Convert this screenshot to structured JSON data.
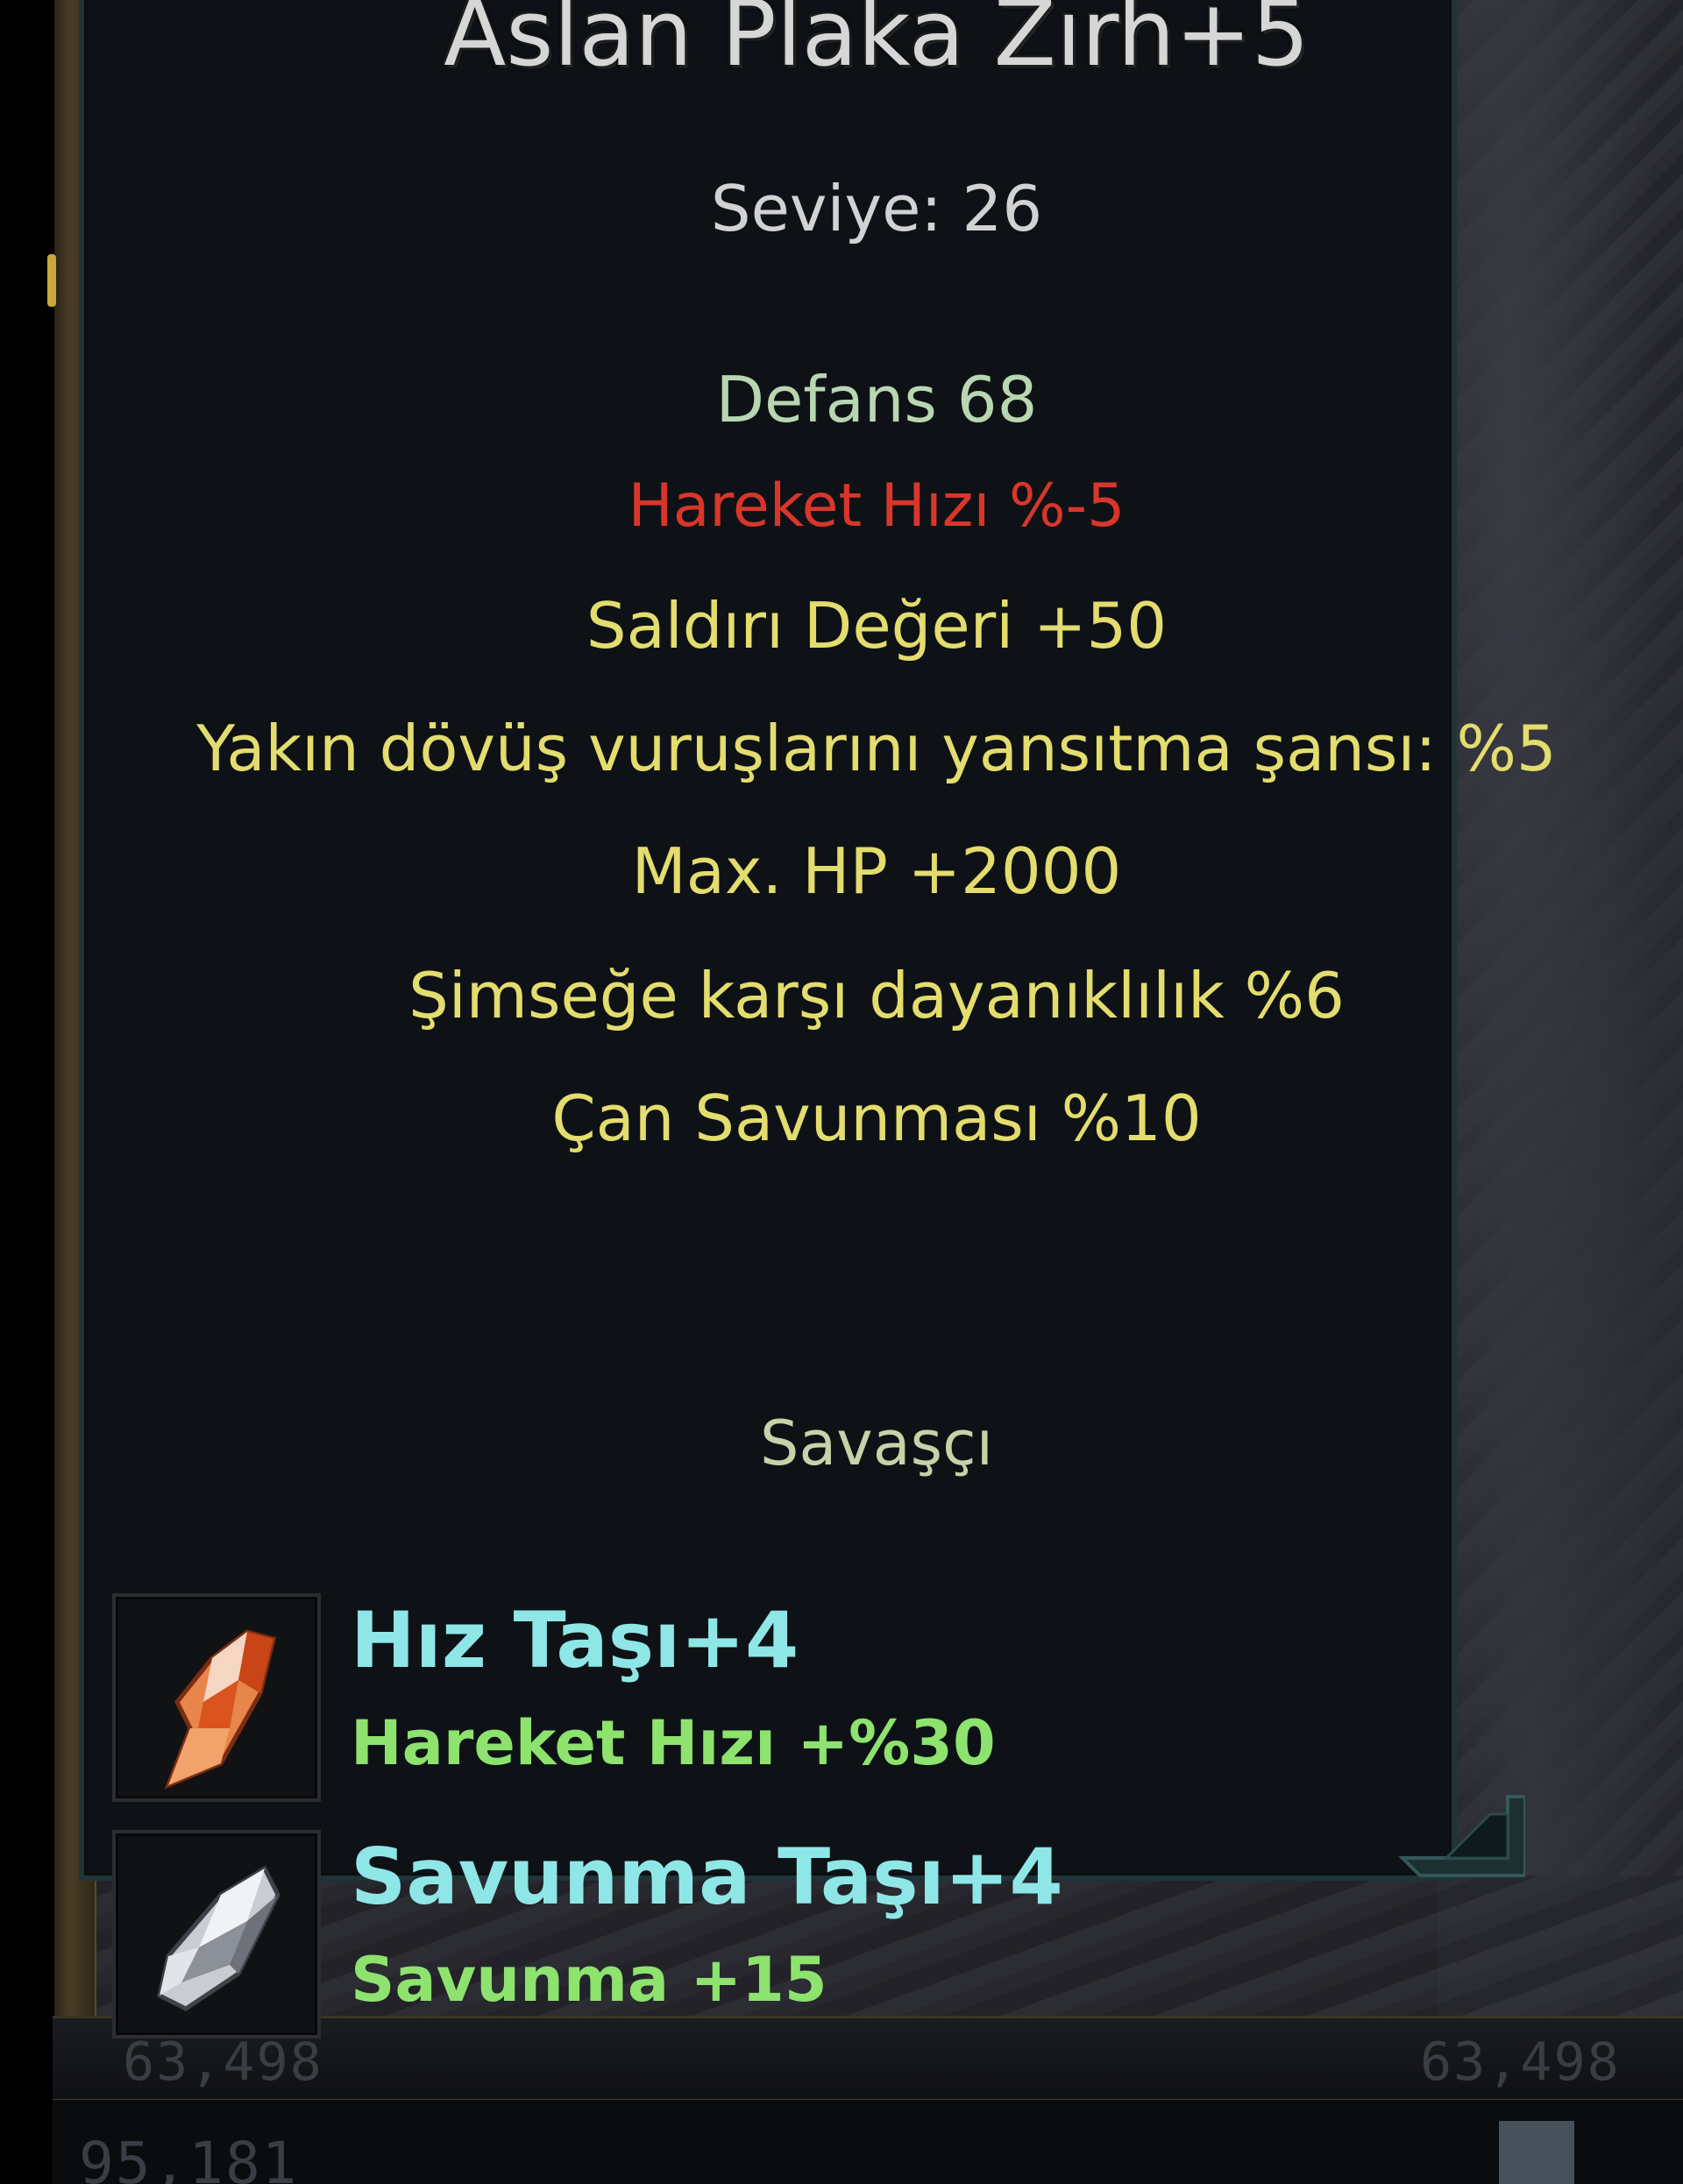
{
  "item": {
    "name": "Aslan Plaka Zırh+5",
    "level": "Seviye: 26",
    "defense": "Defans 68",
    "penalty": "Hareket Hızı %-5",
    "bonuses": [
      "Saldırı Değeri +50",
      "Yakın dövüş vuruşlarını yansıtma şansı: %5",
      "Max. HP +2000",
      "Şimseğe karşı dayanıklılık %6",
      "Çan Savunması %10"
    ],
    "class": "Savaşçı"
  },
  "stones": [
    {
      "name": "Hız Taşı+4",
      "bonus": "Hareket Hızı +%30",
      "icon": "speed-stone-icon"
    },
    {
      "name": "Savunma Taşı+4",
      "bonus": "Savunma +15",
      "icon": "defense-stone-icon"
    }
  ],
  "background_numbers": {
    "left": "63,498",
    "right": "63,498",
    "bottom": "95,181"
  },
  "colors": {
    "title": "#d6d6d6",
    "defense": "#b9d6b2",
    "penalty": "#d8362a",
    "bonus": "#e3dc6e",
    "stone_name": "#8fe6e6",
    "stone_bonus": "#8ee26e"
  }
}
